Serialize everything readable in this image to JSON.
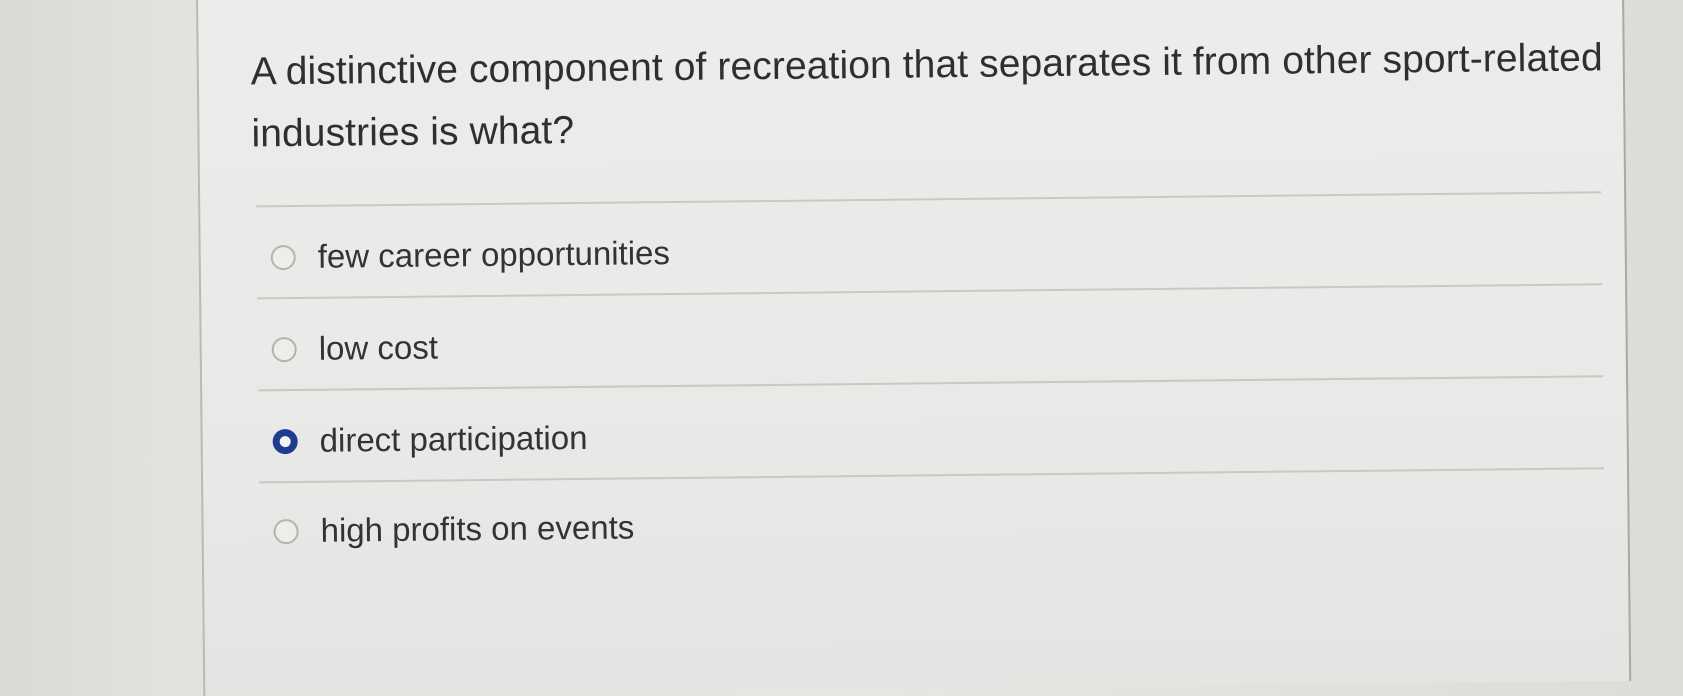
{
  "question": {
    "text": "A distinctive component of recreation that separates it from other sport-related industries is what?"
  },
  "options": [
    {
      "label": "few career opportunities",
      "selected": false
    },
    {
      "label": "low cost",
      "selected": false
    },
    {
      "label": "direct participation",
      "selected": true
    },
    {
      "label": "high profits on events",
      "selected": false
    }
  ],
  "colors": {
    "selected_radio": "#1d3d8f",
    "text": "#333333"
  }
}
